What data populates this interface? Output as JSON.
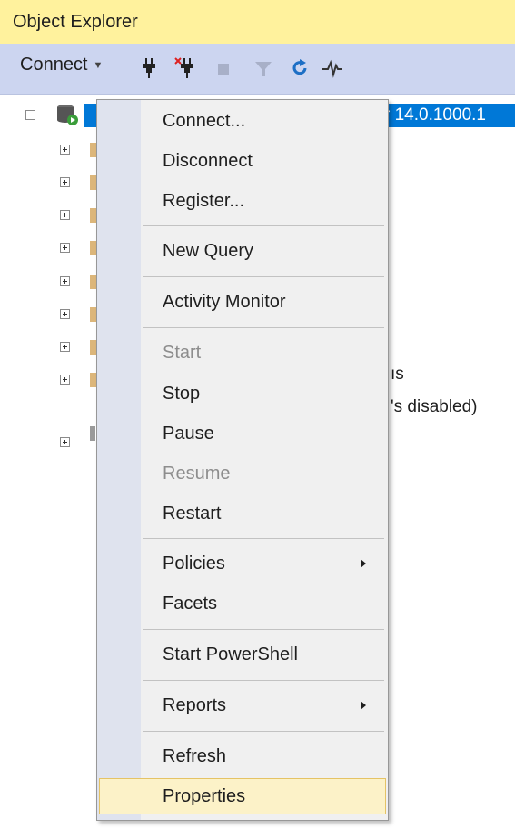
{
  "window": {
    "title": "Object Explorer"
  },
  "toolbar": {
    "connect_label": "Connect",
    "icons": [
      "connect-plug-icon",
      "disconnect-plug-icon",
      "stop-icon",
      "filter-icon",
      "refresh-icon",
      "activity-monitor-icon"
    ]
  },
  "tree": {
    "server_label": "r 14.0.1000.1",
    "agent_fragment_1": "ıs",
    "agent_fragment_2": "'s disabled)"
  },
  "context_menu": {
    "items": [
      {
        "label": "Connect...",
        "enabled": true
      },
      {
        "label": "Disconnect",
        "enabled": true
      },
      {
        "label": "Register...",
        "enabled": true
      },
      {
        "label": "New Query",
        "enabled": true
      },
      {
        "label": "Activity Monitor",
        "enabled": true
      },
      {
        "label": "Start",
        "enabled": false
      },
      {
        "label": "Stop",
        "enabled": true
      },
      {
        "label": "Pause",
        "enabled": true
      },
      {
        "label": "Resume",
        "enabled": false
      },
      {
        "label": "Restart",
        "enabled": true
      },
      {
        "label": "Policies",
        "enabled": true,
        "submenu": true
      },
      {
        "label": "Facets",
        "enabled": true
      },
      {
        "label": "Start PowerShell",
        "enabled": true
      },
      {
        "label": "Reports",
        "enabled": true,
        "submenu": true
      },
      {
        "label": "Refresh",
        "enabled": true
      },
      {
        "label": "Properties",
        "enabled": true,
        "highlighted": true
      }
    ]
  },
  "colors": {
    "title_bg": "#fff29d",
    "toolbar_bg": "#ccd5f0",
    "selection": "#0078d7",
    "menu_bg": "#f0f0f0",
    "menu_gutter": "#dfe3ee",
    "highlight_bg": "#fcf2c8",
    "highlight_border": "#e5c365"
  }
}
